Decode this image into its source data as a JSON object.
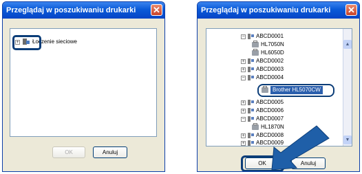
{
  "left_dialog": {
    "title": "Przeglądaj w poszukiwaniu drukarki",
    "close_glyph": "✕",
    "tree": [
      {
        "label": "Łoczenie sieciowe",
        "expander": "+"
      }
    ],
    "ok_label": "OK",
    "cancel_label": "Anuluj"
  },
  "right_dialog": {
    "title": "Przeglądaj w poszukiwaniu drukarki",
    "close_glyph": "✕",
    "tree": [
      {
        "label": "ABCD0001",
        "expander": "−",
        "type": "computer"
      },
      {
        "label": "HL7050N",
        "type": "printer"
      },
      {
        "label": "HL6050D",
        "type": "printer"
      },
      {
        "label": "ABCD0002",
        "expander": "+",
        "type": "computer"
      },
      {
        "label": "ABCD0003",
        "expander": "+",
        "type": "computer"
      },
      {
        "label": "ABCD0004",
        "expander": "−",
        "type": "computer"
      },
      {
        "label": "Brother HL5070CW",
        "type": "printer",
        "selected": true
      },
      {
        "label": "ABCD0005",
        "expander": "+",
        "type": "computer"
      },
      {
        "label": "ABCD0006",
        "expander": "+",
        "type": "computer"
      },
      {
        "label": "ABCD0007",
        "expander": "−",
        "type": "computer"
      },
      {
        "label": "HL1870N",
        "type": "printer"
      },
      {
        "label": "ABCD0008",
        "expander": "+",
        "type": "computer"
      },
      {
        "label": "ABCD0009",
        "expander": "+",
        "type": "computer"
      }
    ],
    "scroll_up_glyph": "▲",
    "scroll_down_glyph": "▼",
    "ok_label": "OK",
    "cancel_label": "Anuluj"
  },
  "colors": {
    "title_bar": "#0a5ad8",
    "highlight": "#0b3d78",
    "selection": "#2b5fad",
    "pointer_arrow": "#1f5fa8"
  }
}
